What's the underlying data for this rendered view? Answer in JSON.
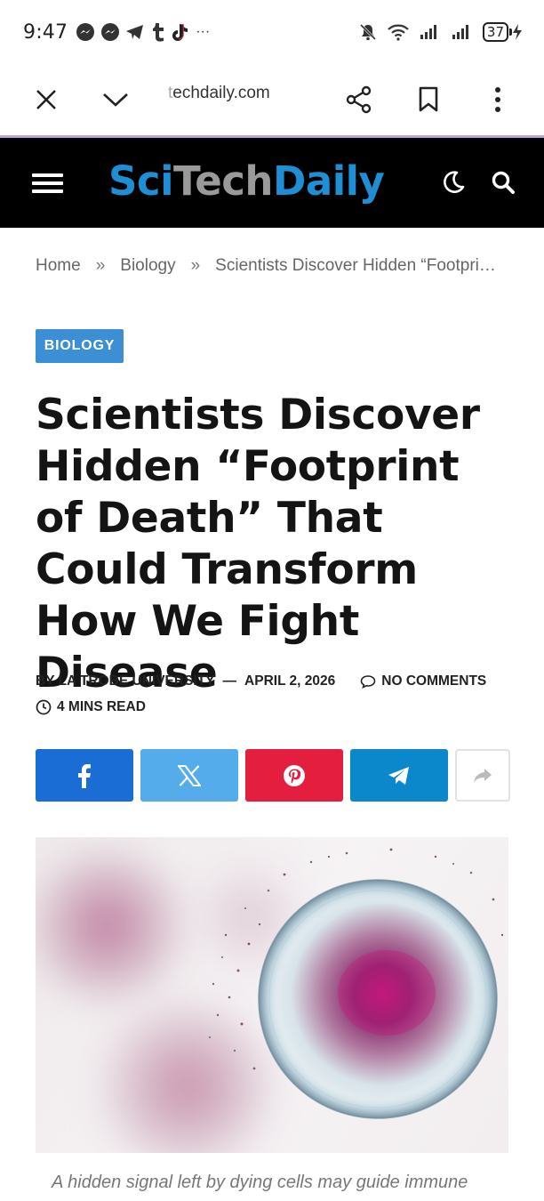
{
  "status_bar": {
    "time": "9:47",
    "battery": "37",
    "notification_icons": [
      "messenger-icon",
      "messenger-icon",
      "telegram-icon",
      "tumblr-icon",
      "tiktok-icon",
      "more-dots-icon"
    ]
  },
  "browser": {
    "url_faded": "t",
    "url": "echdaily.com"
  },
  "site": {
    "logo_sci": "Sci",
    "logo_tech": "Tech",
    "logo_daily": "Daily"
  },
  "breadcrumb": {
    "home": "Home",
    "separator": "»",
    "category": "Biology",
    "current": "Scientists Discover Hidden “Footpri…"
  },
  "article": {
    "category_badge": "BIOLOGY",
    "title": "Scientists Discover Hidden “Footprint of Death” That Could Transform How We Fight Disease",
    "byline": "BY LA TROBE UNIVERSITY",
    "dash": "—",
    "date": "APRIL 2, 2026",
    "comments": "NO COMMENTS",
    "read_time": "4 MINS READ",
    "caption": "A hidden signal left by dying cells may guide immune"
  },
  "share": {
    "facebook_color": "#1a6dd4",
    "x_color": "#54acea",
    "pinterest_color": "#e41e3f",
    "telegram_color": "#0b87cc"
  }
}
